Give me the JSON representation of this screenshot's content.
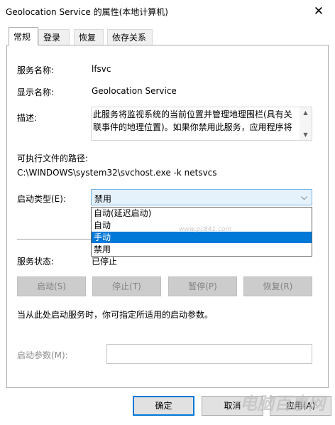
{
  "window": {
    "title": "Geolocation Service 的属性(本地计算机)",
    "close_glyph": "✕"
  },
  "tabs": [
    {
      "label": "常规",
      "active": true
    },
    {
      "label": "登录"
    },
    {
      "label": "恢复"
    },
    {
      "label": "依存关系"
    }
  ],
  "general": {
    "service_name_label": "服务名称:",
    "service_name_value": "lfsvc",
    "display_name_label": "显示名称:",
    "display_name_value": "Geolocation Service",
    "description_label": "描述:",
    "description_value": "此服务将监视系统的当前位置并管理地理围栏(具有关联事件的地理位置)。如果你禁用此服务，应用程序将",
    "exe_path_label": "可执行文件的路径:",
    "exe_path_value": "C:\\WINDOWS\\system32\\svchost.exe -k netsvcs",
    "startup_type_label": "启动类型(E):",
    "startup_type_value": "禁用",
    "startup_options": [
      "自动(延迟启动)",
      "自动",
      "手动",
      "禁用"
    ],
    "startup_selected_index": 2,
    "service_status_label": "服务状态:",
    "service_status_value": "已停止",
    "start_button": "启动(S)",
    "stop_button": "停止(T)",
    "pause_button": "暂停(P)",
    "resume_button": "恢复(R)",
    "hint_text": "当从此处启动服务时，你可指定所适用的启动参数。",
    "start_params_label": "启动参数(M):",
    "start_params_value": ""
  },
  "footer": {
    "ok_button": "确定",
    "cancel_button": "取消",
    "apply_button": "应用(A)"
  },
  "watermark": {
    "text": "电脑百事网",
    "url_text": "www.pc841.com"
  }
}
